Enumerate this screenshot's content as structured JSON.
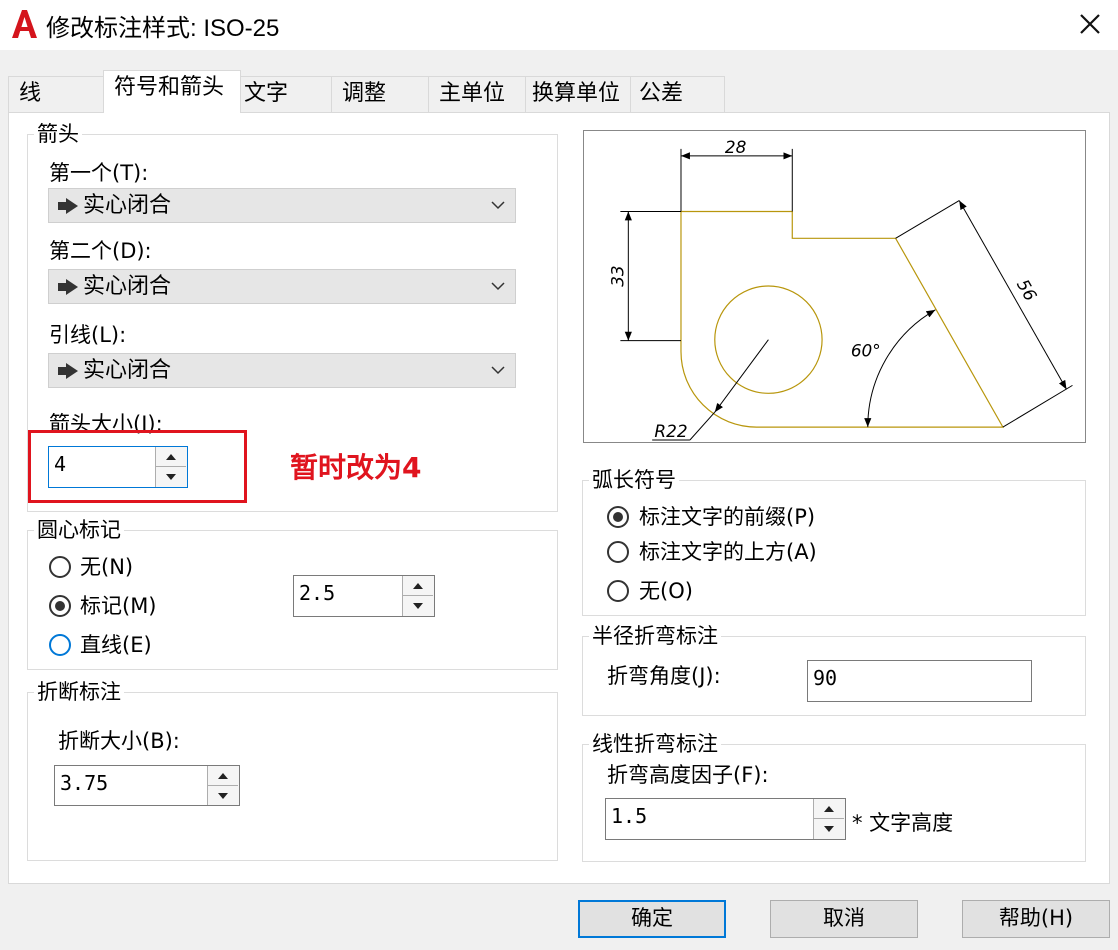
{
  "window": {
    "title": "修改标注样式: ISO-25",
    "close_symbol": "✕"
  },
  "tabs": [
    "线",
    "符号和箭头",
    "文字",
    "调整",
    "主单位",
    "换算单位",
    "公差"
  ],
  "arrowheads": {
    "legend": "箭头",
    "first_label": "第一个(T):",
    "first_value": "实心闭合",
    "second_label": "第二个(D):",
    "second_value": "实心闭合",
    "leader_label": "引线(L):",
    "leader_value": "实心闭合",
    "size_label": "箭头大小(I):",
    "size_value": "4"
  },
  "annotation": {
    "text": "暂时改为4",
    "color": "#e0141e"
  },
  "center_marks": {
    "legend": "圆心标记",
    "none_label": "无(N)",
    "mark_label": "标记(M)",
    "line_label": "直线(E)",
    "selected": "mark",
    "size_value": "2.5"
  },
  "dim_break": {
    "legend": "折断标注",
    "size_label": "折断大小(B):",
    "size_value": "3.75"
  },
  "preview": {
    "dim_28": "28",
    "dim_33": "33",
    "dim_56": "56",
    "angle": "60°",
    "radius": "R22"
  },
  "arc_length": {
    "legend": "弧长符号",
    "prefix_label": "标注文字的前缀(P)",
    "above_label": "标注文字的上方(A)",
    "none_label": "无(O)",
    "selected": "prefix"
  },
  "radius_jog": {
    "legend": "半径折弯标注",
    "angle_label": "折弯角度(J):",
    "angle_value": "90"
  },
  "linear_jog": {
    "legend": "线性折弯标注",
    "factor_label": "折弯高度因子(F):",
    "factor_value": "1.5",
    "unit_label": "* 文字高度"
  },
  "buttons": {
    "ok": "确定",
    "cancel": "取消",
    "help": "帮助(H)"
  },
  "colors": {
    "accent": "#0078d7",
    "highlight": "#e0141e",
    "preview_outline": "#b8960c"
  }
}
